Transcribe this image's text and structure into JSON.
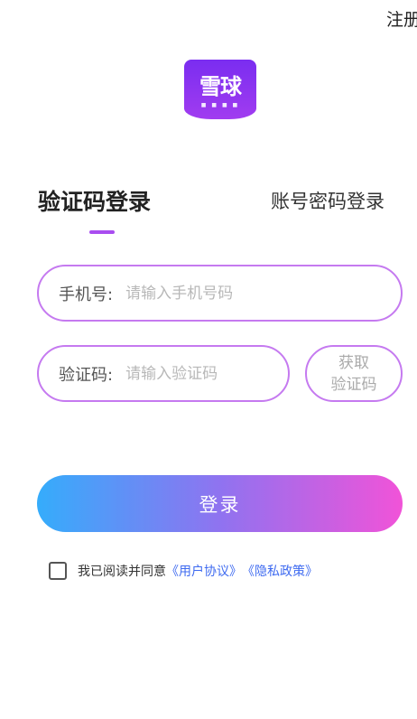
{
  "header": {
    "register_label": "注册"
  },
  "logo": {
    "text": "雪球",
    "subtitle": "■ ■ ■ ■",
    "color_top": "#7a2df0",
    "color_bottom": "#a13cf0"
  },
  "tabs": {
    "active_label": "验证码登录",
    "inactive_label": "账号密码登录",
    "indicator_color": "#a94df0"
  },
  "form": {
    "phone": {
      "label": "手机号:",
      "placeholder": "请输入手机号码",
      "value": ""
    },
    "code": {
      "label": "验证码:",
      "placeholder": "请输入验证码",
      "value": ""
    },
    "get_code": {
      "line1": "获取",
      "line2": "验证码"
    },
    "border_color": "#c57af0"
  },
  "login": {
    "label": "登录",
    "gradient_start": "#2aa8fb",
    "gradient_end": "#f04ad6"
  },
  "agreement": {
    "checked": false,
    "prefix": "我已阅读并同意",
    "user_agreement": "《用户协议》",
    "privacy_policy": "《隐私政策》",
    "link_color": "#3f6bf0"
  }
}
